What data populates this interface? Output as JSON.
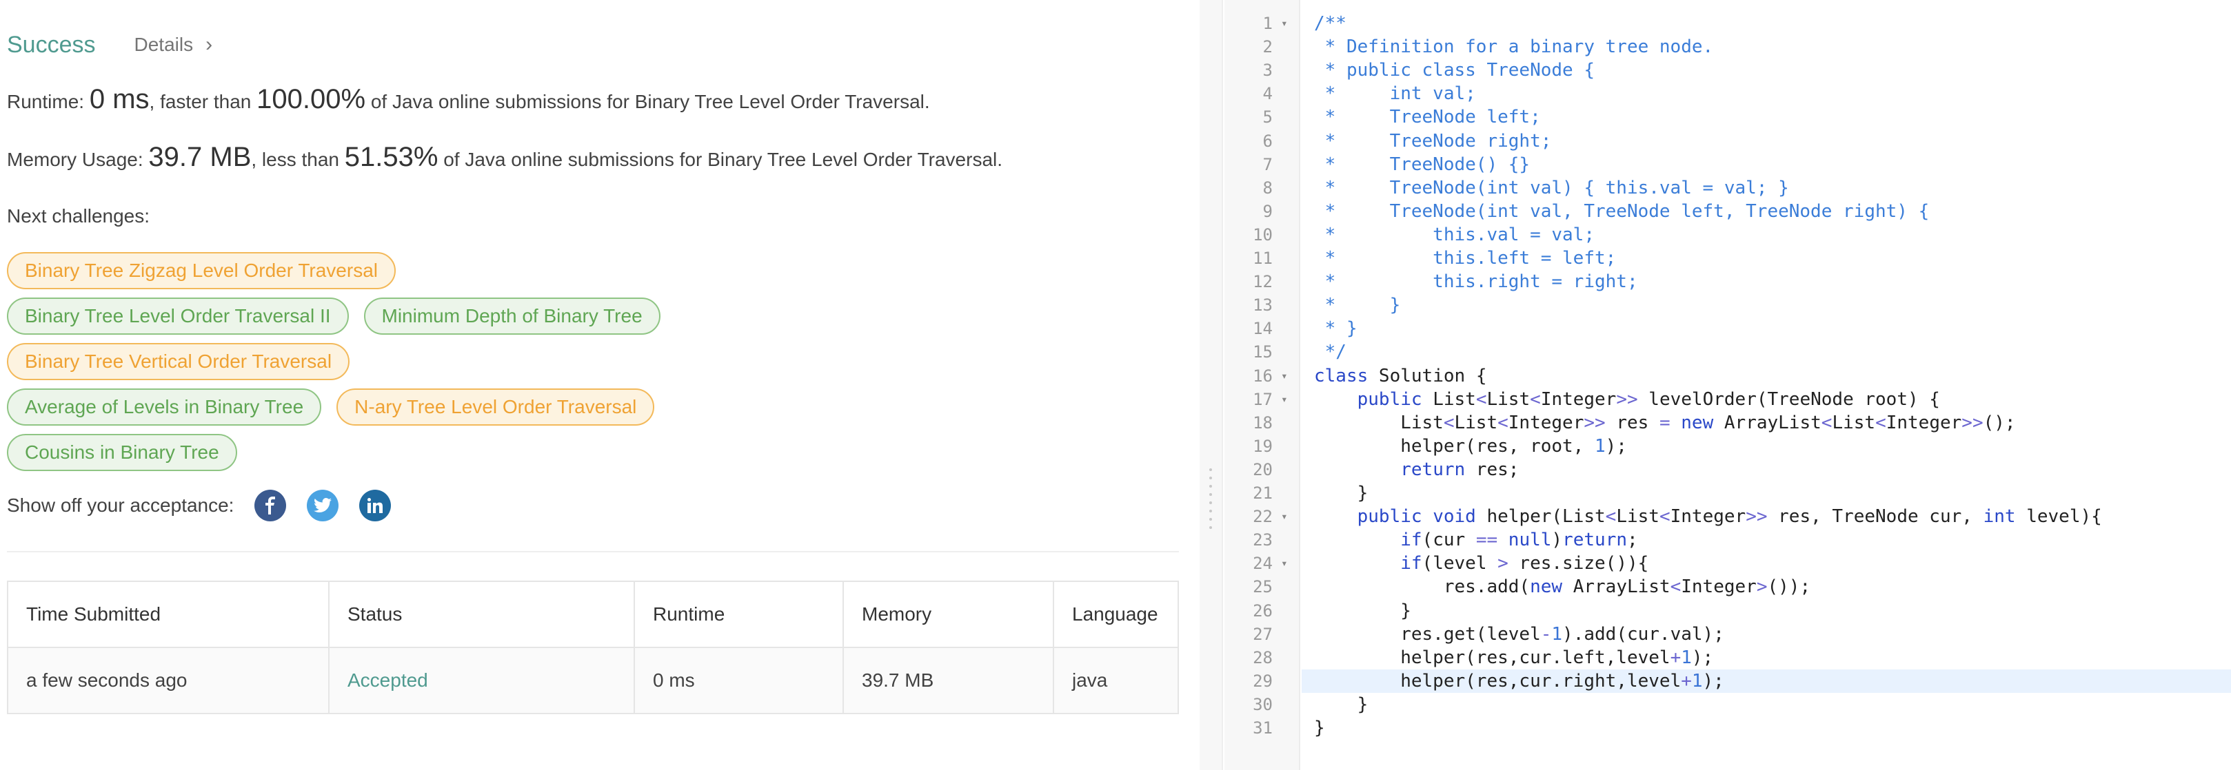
{
  "result": {
    "status": "Success",
    "details_label": "Details",
    "details_chevron": "›"
  },
  "runtime": {
    "prefix": "Runtime: ",
    "value": "0 ms",
    "middle": ", faster than ",
    "percent": "100.00%",
    "suffix": " of Java online submissions for Binary Tree Level Order Traversal."
  },
  "memory": {
    "prefix": "Memory Usage: ",
    "value": "39.7 MB",
    "middle": ", less than ",
    "percent": "51.53%",
    "suffix": " of Java online submissions for Binary Tree Level Order Traversal."
  },
  "next_challenges": {
    "label": "Next challenges:",
    "tags": [
      "Binary Tree Zigzag Level Order Traversal",
      "Binary Tree Level Order Traversal II",
      "Minimum Depth of Binary Tree",
      "Binary Tree Vertical Order Traversal",
      "Average of Levels in Binary Tree",
      "N-ary Tree Level Order Traversal",
      "Cousins in Binary Tree"
    ]
  },
  "share": {
    "label": "Show off your acceptance:",
    "icons": [
      "facebook-icon",
      "twitter-icon",
      "linkedin-icon"
    ]
  },
  "submissions": {
    "headers": [
      "Time Submitted",
      "Status",
      "Runtime",
      "Memory",
      "Language"
    ],
    "rows": [
      [
        "a few seconds ago",
        "Accepted",
        "0 ms",
        "39.7 MB",
        "java"
      ]
    ]
  },
  "colors": {
    "success": "#4f9a8f",
    "tag_orange": "#efa233",
    "tag_green": "#5fa653",
    "comment": "#3b7dd8",
    "keyword": "#2a48c8",
    "line_highlight": "#e8f2fe"
  },
  "editor": {
    "highlighted_line": 29,
    "fold_lines": [
      1,
      16,
      17,
      22,
      24
    ],
    "lines": [
      "/**",
      " * Definition for a binary tree node.",
      " * public class TreeNode {",
      " *     int val;",
      " *     TreeNode left;",
      " *     TreeNode right;",
      " *     TreeNode() {}",
      " *     TreeNode(int val) { this.val = val; }",
      " *     TreeNode(int val, TreeNode left, TreeNode right) {",
      " *         this.val = val;",
      " *         this.left = left;",
      " *         this.right = right;",
      " *     }",
      " * }",
      " */",
      "class Solution {",
      "    public List<List<Integer>> levelOrder(TreeNode root) {",
      "        List<List<Integer>> res = new ArrayList<List<Integer>>();",
      "        helper(res, root, 1);",
      "        return res;",
      "    }",
      "    public void helper(List<List<Integer>> res, TreeNode cur, int level){",
      "        if(cur == null)return;",
      "        if(level > res.size()){",
      "            res.add(new ArrayList<Integer>());",
      "        }",
      "        res.get(level-1).add(cur.val);",
      "        helper(res,cur.left,level+1);",
      "        helper(res,cur.right,level+1);",
      "    }",
      "}"
    ]
  }
}
